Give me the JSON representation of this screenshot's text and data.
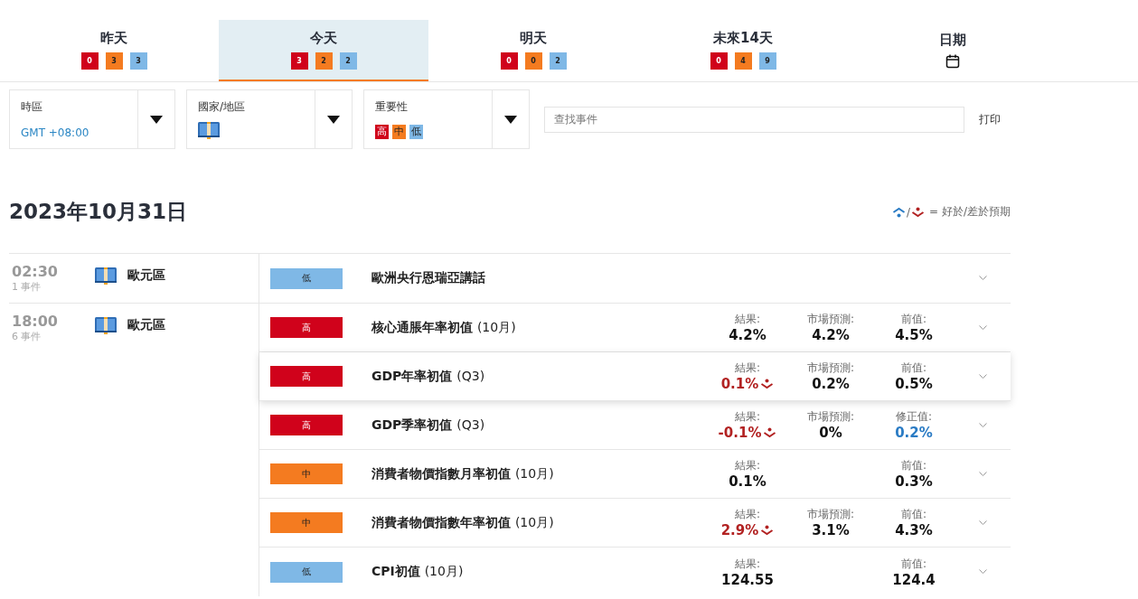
{
  "tabs": [
    {
      "kind": "counts",
      "label": "昨天",
      "selected": false,
      "counts": [
        {
          "kind": "high",
          "value": "0"
        },
        {
          "kind": "medium",
          "value": "3"
        },
        {
          "kind": "low",
          "value": "3"
        }
      ]
    },
    {
      "kind": "counts",
      "label": "今天",
      "selected": true,
      "counts": [
        {
          "kind": "high",
          "value": "3"
        },
        {
          "kind": "medium",
          "value": "2"
        },
        {
          "kind": "low",
          "value": "2"
        }
      ]
    },
    {
      "kind": "counts",
      "label": "明天",
      "selected": false,
      "counts": [
        {
          "kind": "high",
          "value": "0"
        },
        {
          "kind": "medium",
          "value": "0"
        },
        {
          "kind": "low",
          "value": "2"
        }
      ]
    },
    {
      "kind": "counts",
      "label": "未來14天",
      "selected": false,
      "counts": [
        {
          "kind": "high",
          "value": "0"
        },
        {
          "kind": "medium",
          "value": "4"
        },
        {
          "kind": "low",
          "value": "9"
        }
      ]
    },
    {
      "kind": "calendar",
      "label": "日期",
      "selected": false
    }
  ],
  "filters": [
    {
      "kind": "text",
      "label": "時區",
      "value": "GMT +08:00"
    },
    {
      "kind": "flag",
      "label": "國家/地區"
    },
    {
      "kind": "importance",
      "label": "重要性",
      "options": [
        {
          "kind": "high",
          "label": "高"
        },
        {
          "kind": "medium",
          "label": "中"
        },
        {
          "kind": "low",
          "label": "低"
        }
      ]
    }
  ],
  "search": {
    "placeholder": "查找事件"
  },
  "print_link": "打印",
  "date_heading": "2023年10月31日",
  "legend": {
    "separator": "/",
    "text": "= 好於/差於預期"
  },
  "groups": [
    {
      "time": "02:30",
      "count": "1 事件",
      "region": "歐元區",
      "events": [
        {
          "kind": "low",
          "badge": "低",
          "title": "歐洲央行恩瑞亞講話",
          "highlighted": false
        }
      ]
    },
    {
      "time": "18:00",
      "count": "6 事件",
      "region": "歐元區",
      "events": [
        {
          "kind": "high",
          "badge": "高",
          "title": "核心通脹年率初值",
          "period": "(10月)",
          "highlighted": false,
          "result": {
            "label": "結果:",
            "value": "4.2%",
            "worse": false
          },
          "forecast": {
            "label": "市場預測:",
            "value": "4.2%"
          },
          "previous": {
            "label": "前值:",
            "value": "4.5%",
            "better": false
          }
        },
        {
          "kind": "high",
          "badge": "高",
          "title": "GDP年率初值",
          "period": "(Q3)",
          "highlighted": true,
          "result": {
            "label": "結果:",
            "value": "0.1%",
            "worse": true
          },
          "forecast": {
            "label": "市場預測:",
            "value": "0.2%"
          },
          "previous": {
            "label": "前值:",
            "value": "0.5%",
            "better": false
          }
        },
        {
          "kind": "high",
          "badge": "高",
          "title": "GDP季率初值",
          "period": "(Q3)",
          "highlighted": false,
          "result": {
            "label": "結果:",
            "value": "-0.1%",
            "worse": true
          },
          "forecast": {
            "label": "市場預測:",
            "value": "0%"
          },
          "previous": {
            "label": "修正值:",
            "value": "0.2%",
            "better": true
          }
        },
        {
          "kind": "medium",
          "badge": "中",
          "title": "消費者物價指數月率初值",
          "period": "(10月)",
          "highlighted": false,
          "result": {
            "label": "結果:",
            "value": "0.1%",
            "worse": false
          },
          "previous": {
            "label": "前值:",
            "value": "0.3%",
            "better": false
          }
        },
        {
          "kind": "medium",
          "badge": "中",
          "title": "消費者物價指數年率初值",
          "period": "(10月)",
          "highlighted": false,
          "result": {
            "label": "結果:",
            "value": "2.9%",
            "worse": true
          },
          "forecast": {
            "label": "市場預測:",
            "value": "3.1%"
          },
          "previous": {
            "label": "前值:",
            "value": "4.3%",
            "better": false
          }
        },
        {
          "kind": "low",
          "badge": "低",
          "title": "CPI初值",
          "period": "(10月)",
          "highlighted": false,
          "result": {
            "label": "結果:",
            "value": "124.55",
            "worse": false
          },
          "previous": {
            "label": "前值:",
            "value": "124.4",
            "better": false
          }
        }
      ]
    }
  ]
}
